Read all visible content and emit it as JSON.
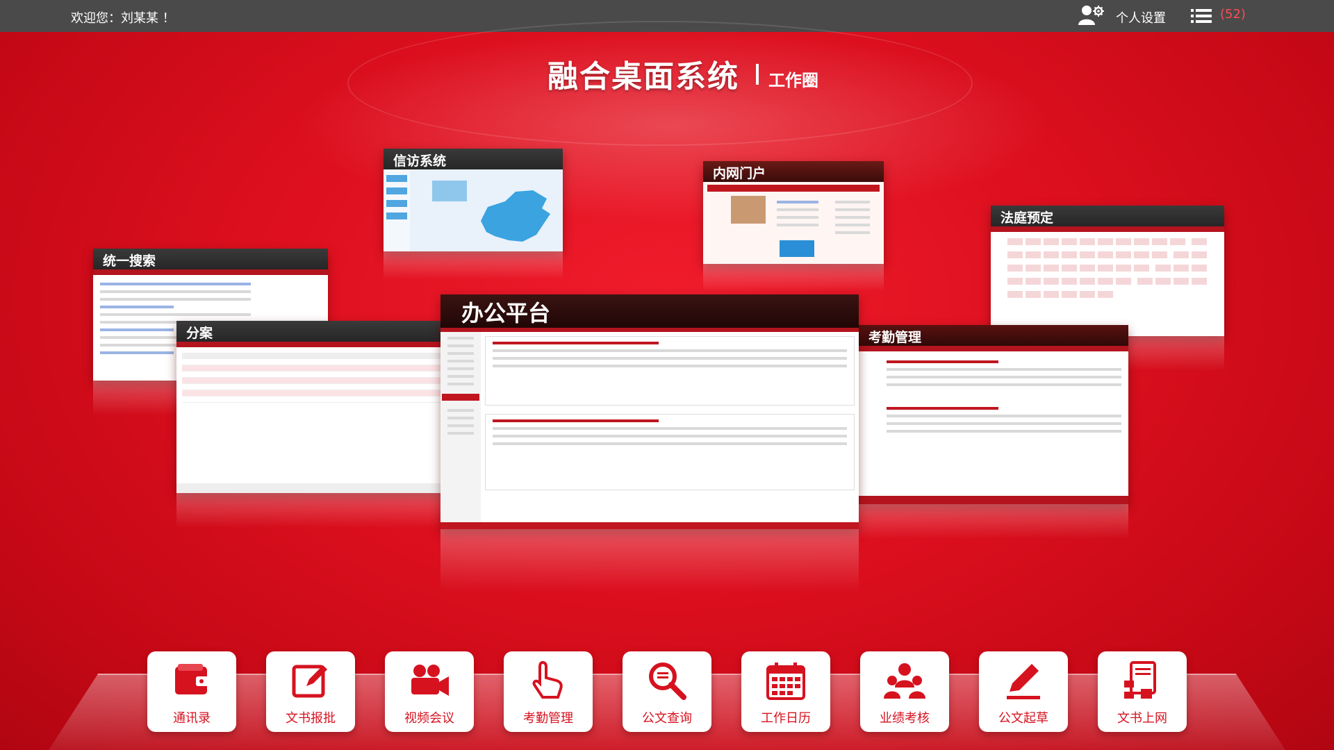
{
  "topbar": {
    "welcome": "欢迎您：刘某某 ！",
    "settings_label": "个人设置",
    "menu_count": "(52)"
  },
  "title": {
    "main": "融合桌面系统",
    "sub": "工作圈"
  },
  "windows": {
    "xinfang": "信访系统",
    "neiwang": "内网门户",
    "fating": "法庭预定",
    "sousuo": "统一搜索",
    "fenan": "分案",
    "bangong": "办公平台",
    "kaoqin": "考勤管理"
  },
  "dock": {
    "items": [
      {
        "label": "通讯录",
        "icon": "wallet-icon"
      },
      {
        "label": "文书报批",
        "icon": "edit-icon"
      },
      {
        "label": "视频会议",
        "icon": "video-camera-icon"
      },
      {
        "label": "考勤管理",
        "icon": "hand-pointer-icon"
      },
      {
        "label": "公文查询",
        "icon": "magnifier-icon"
      },
      {
        "label": "工作日历",
        "icon": "calendar-icon"
      },
      {
        "label": "业绩考核",
        "icon": "users-icon"
      },
      {
        "label": "公文起草",
        "icon": "pen-icon"
      },
      {
        "label": "文书上网",
        "icon": "document-network-icon"
      }
    ]
  },
  "colors": {
    "background": "#dc0f1e",
    "topbar": "#4a4a4a",
    "accent": "#d6121f",
    "badge": "#ff4b55"
  }
}
